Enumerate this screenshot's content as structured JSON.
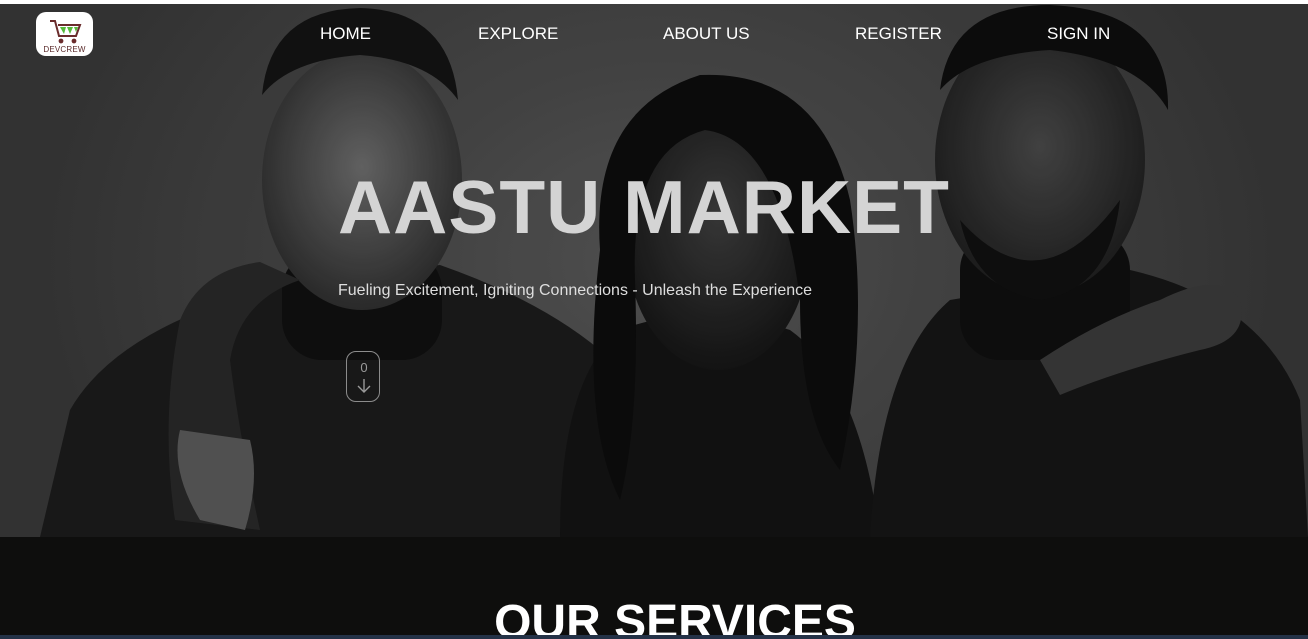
{
  "brand": {
    "logo_text": "DEVCREW",
    "logo_icon": "shopping-cart-icon",
    "logo_accent": "#55b93a"
  },
  "nav": {
    "items": [
      {
        "label": "HOME"
      },
      {
        "label": "EXPLORE"
      },
      {
        "label": "ABOUT US"
      },
      {
        "label": "REGISTER"
      },
      {
        "label": "SIGN IN"
      }
    ]
  },
  "hero": {
    "title": "AASTU MARKET",
    "subtitle": "Fueling Excitement, Igniting Connections - Unleash the Experience",
    "scroll_icon": "mouse-scroll-down-icon"
  },
  "services": {
    "title": "OUR SERVICES"
  },
  "colors": {
    "page_background": "#0e0e0d",
    "nav_text": "#ffffff",
    "hero_title": "#d4d4d4"
  }
}
